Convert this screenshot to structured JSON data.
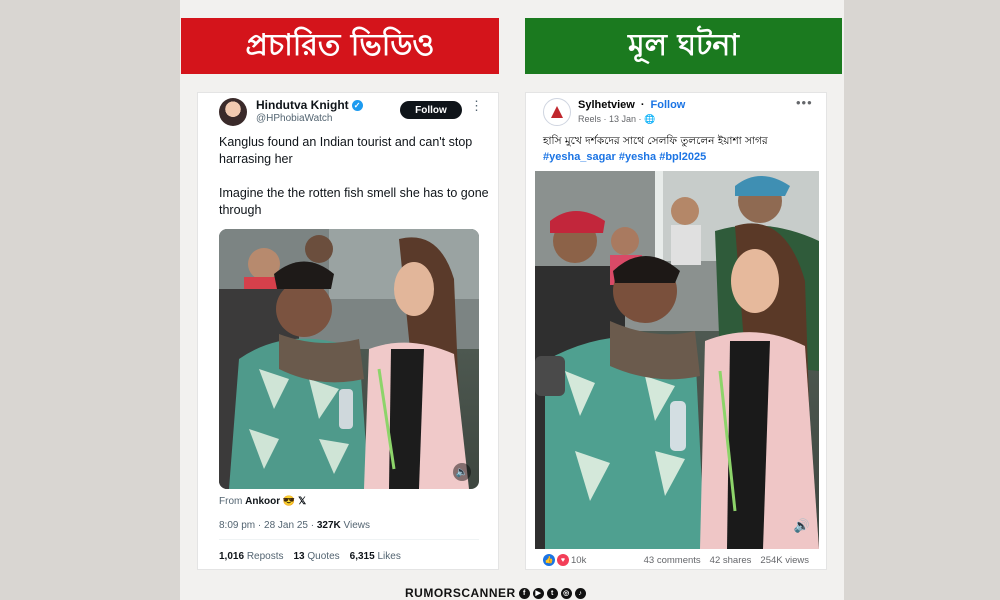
{
  "banners": {
    "left": "প্রচারিত ভিডিও",
    "right": "মূল ঘটনা"
  },
  "tweet": {
    "author": "Hindutva Knight",
    "handle": "@HPhobiaWatch",
    "follow_label": "Follow",
    "more": "⋮",
    "paragraphs": [
      "Kanglus found an Indian tourist and can't stop harrasing her",
      "Imagine the the rotten fish smell she has to gone through"
    ],
    "from_prefix": "From",
    "from_name": "Ankoor 😎 𝕏",
    "time": "8:09 pm · 28 Jan 25 ·",
    "views_count": "327K",
    "views_label": "Views",
    "reposts_count": "1,016",
    "reposts_label": "Reposts",
    "quotes_count": "13",
    "quotes_label": "Quotes",
    "likes_count": "6,315",
    "likes_label": "Likes",
    "sound_icon": "🔈"
  },
  "fbpost": {
    "page_name": "Sylhetview",
    "dot": "·",
    "follow_label": "Follow",
    "meta": "Reels · 13 Jan · 🌐",
    "more": "•••",
    "caption": "হাসি মুখে দর্শকদের সাথে সেলফি তুললেন ইয়াশা সাগর",
    "tags": "#yesha_sagar #yesha #bpl2025",
    "reaction_count": "10k",
    "comments": "43 comments",
    "shares": "42 shares",
    "views": "254K views",
    "sound_icon": "🔊"
  },
  "footer": {
    "brand": "RUMORSCANNER",
    "icons": [
      "f",
      "▶",
      "t",
      "◎",
      "♪"
    ]
  },
  "colors": {
    "red_banner": "#d4141b",
    "green_banner": "#1b7a1f",
    "link_blue": "#1b74e4",
    "twitter_blue": "#1d9bf0"
  }
}
